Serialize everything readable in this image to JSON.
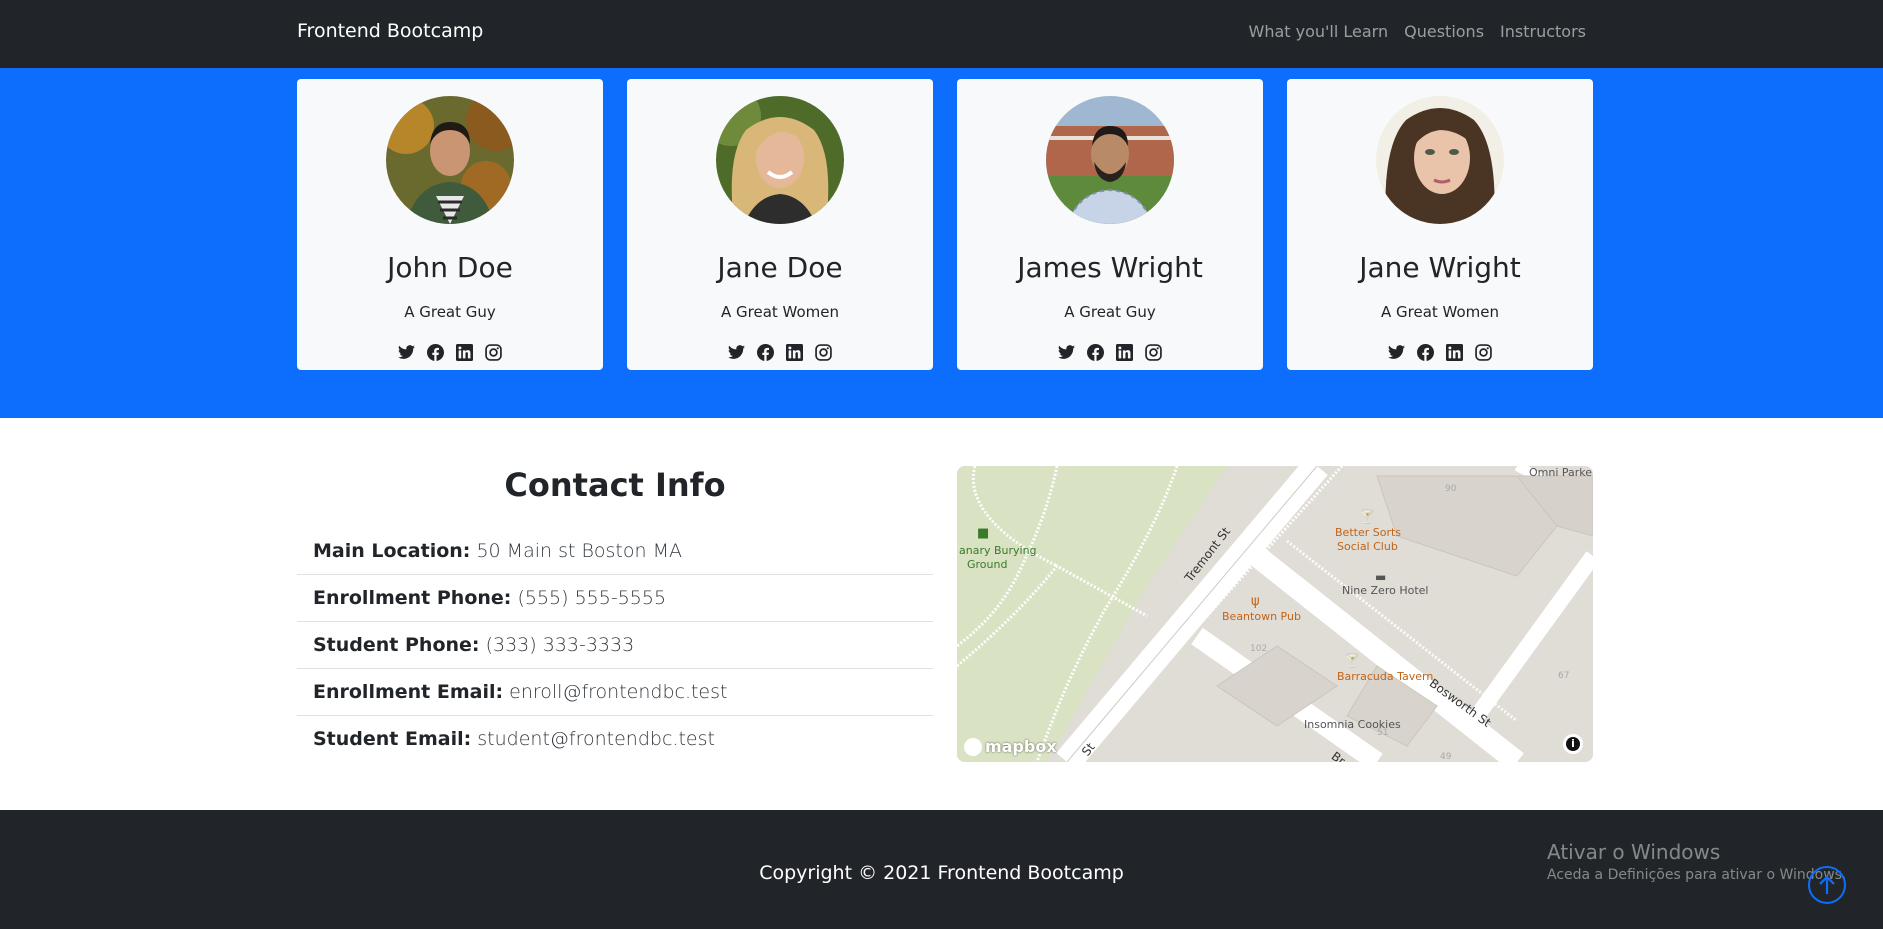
{
  "navbar": {
    "brand": "Frontend Bootcamp",
    "links": [
      "What you'll Learn",
      "Questions",
      "Instructors"
    ]
  },
  "instructors": [
    {
      "name": "John Doe",
      "role": "A Great Guy"
    },
    {
      "name": "Jane Doe",
      "role": "A Great Women"
    },
    {
      "name": "James Wright",
      "role": "A Great Guy"
    },
    {
      "name": "Jane Wright",
      "role": "A Great Women"
    }
  ],
  "social_icons": [
    "twitter-icon",
    "facebook-icon",
    "linkedin-icon",
    "instagram-icon"
  ],
  "contact": {
    "title": "Contact Info",
    "items": [
      {
        "label": "Main Location:",
        "value": "50 Main st Boston MA"
      },
      {
        "label": "Enrollment Phone:",
        "value": "(555) 555-5555"
      },
      {
        "label": "Student Phone:",
        "value": "(333) 333-3333"
      },
      {
        "label": "Enrollment Email:",
        "value": "enroll@frontendbc.test"
      },
      {
        "label": "Student Email:",
        "value": "student@frontendbc.test"
      }
    ]
  },
  "map": {
    "labels": {
      "burying_ground_1": "anary Burying",
      "burying_ground_2": "Ground",
      "tremont": "Tremont St",
      "better_sorts_1": "Better Sorts",
      "better_sorts_2": "Social Club",
      "nine_zero": "Nine Zero Hotel",
      "beantown": "Beantown Pub",
      "barracuda": "Barracuda Tavern",
      "bosworth": "Bosworth St",
      "insomnia": "Insomnia Cookies",
      "omni": "Omni Parke",
      "number_102": "102",
      "number_51": "51",
      "number_49": "49",
      "number_90": "90",
      "number_67": "67",
      "partial_st": "St",
      "partial_br": "Br"
    },
    "logo": "mapbox",
    "info": "i"
  },
  "footer": {
    "copyright": "Copyright © 2021 Frontend Bootcamp",
    "windows_title": "Ativar o Windows",
    "windows_sub": "Aceda a Definições para ativar o Windows."
  },
  "colors": {
    "navbar_bg": "#212529",
    "primary": "#0d6efd",
    "card_bg": "#f8f9fa"
  }
}
